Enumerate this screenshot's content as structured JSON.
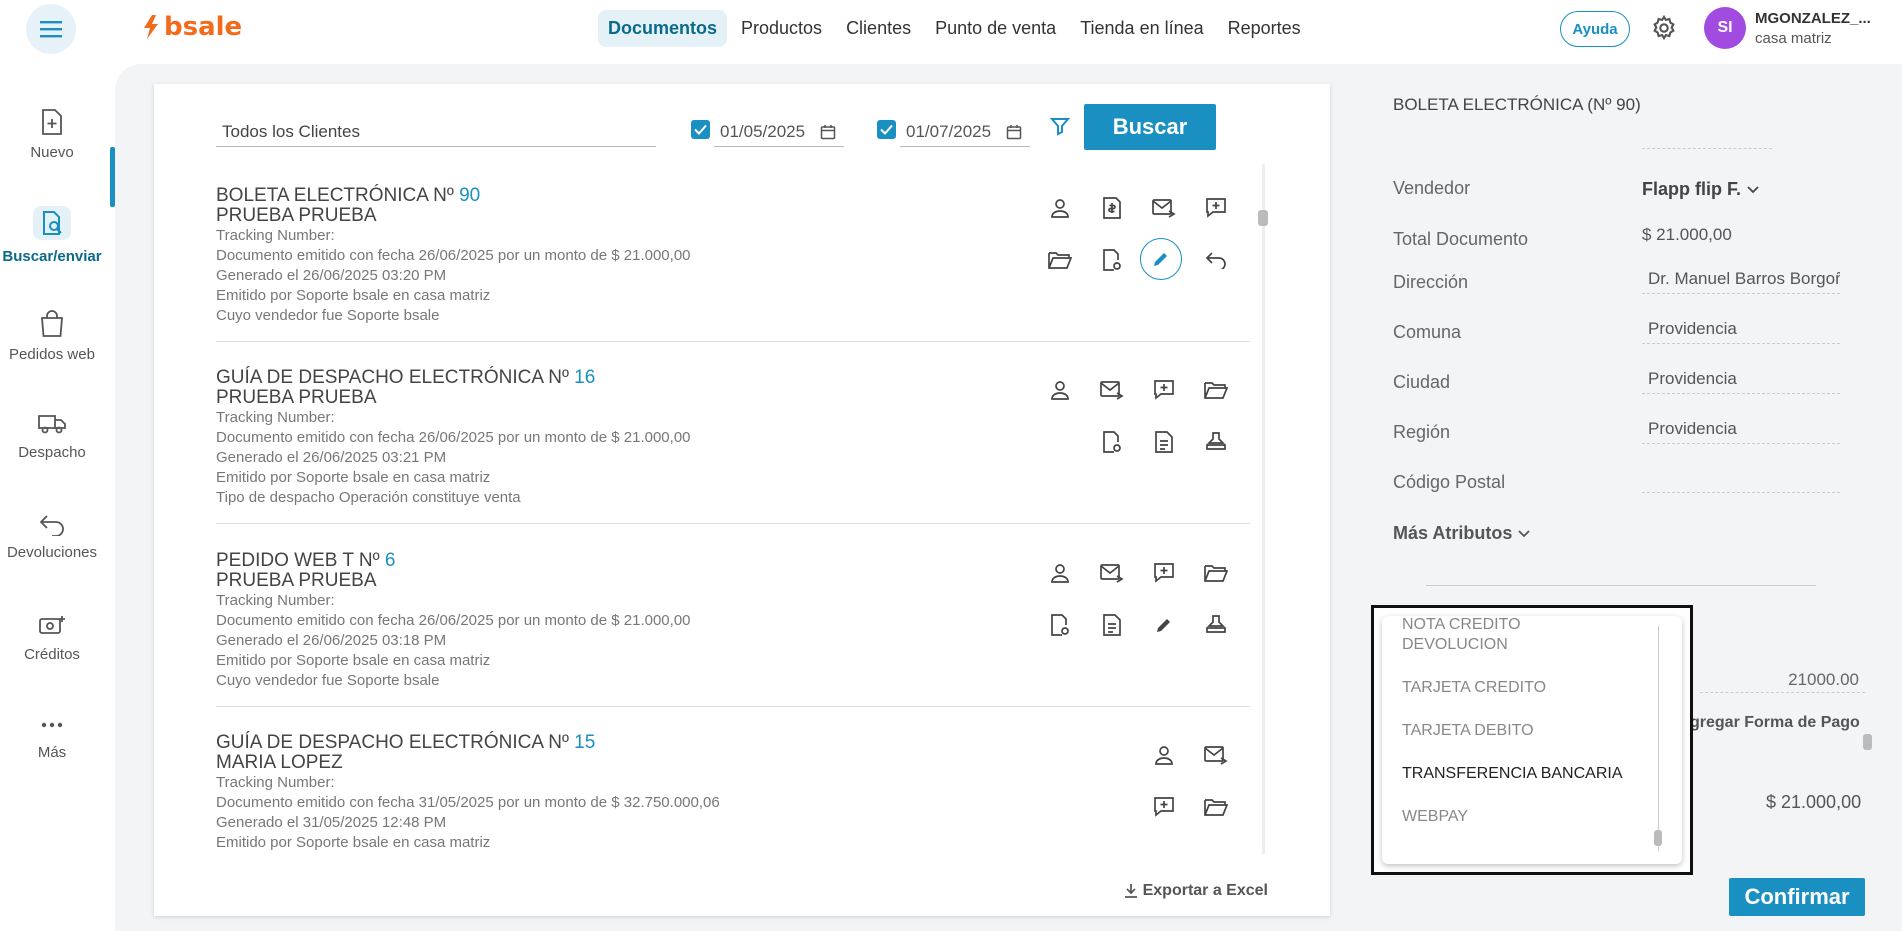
{
  "brand": {
    "name": "bsale"
  },
  "nav": {
    "items": [
      "Documentos",
      "Productos",
      "Clientes",
      "Punto de venta",
      "Tienda en línea",
      "Reportes"
    ]
  },
  "header": {
    "help": "Ayuda",
    "user_name": "MGONZALEZ_...",
    "user_branch": "casa matriz",
    "avatar": "SI"
  },
  "sidebar": {
    "items": [
      "Nuevo",
      "Buscar/enviar",
      "Pedidos web",
      "Despacho",
      "Devoluciones",
      "Créditos",
      "Más"
    ]
  },
  "filters": {
    "client": "Todos los Clientes",
    "date_from": "01/05/2025",
    "date_to": "01/07/2025",
    "search": "Buscar"
  },
  "documents": [
    {
      "title": "BOLETA ELECTRÓNICA Nº",
      "number": "90",
      "client": "PRUEBA PRUEBA",
      "lines": [
        "Tracking Number:",
        "Documento emitido con fecha 26/06/2025 por un monto de $ 21.000,00",
        "Generado el 26/06/2025 03:20 PM",
        "Emitido por Soporte bsale en casa matriz",
        "Cuyo vendedor fue Soporte bsale"
      ]
    },
    {
      "title": "GUÍA DE DESPACHO ELECTRÓNICA Nº",
      "number": "16",
      "client": "PRUEBA PRUEBA",
      "lines": [
        "Tracking Number:",
        "Documento emitido con fecha 26/06/2025 por un monto de $ 21.000,00",
        "Generado el 26/06/2025 03:21 PM",
        "Emitido por Soporte bsale en casa matriz",
        "Tipo de despacho Operación constituye venta"
      ]
    },
    {
      "title": "PEDIDO WEB T Nº",
      "number": "6",
      "client": "PRUEBA PRUEBA",
      "lines": [
        "Tracking Number:",
        "Documento emitido con fecha 26/06/2025 por un monto de $ 21.000,00",
        "Generado el 26/06/2025 03:18 PM",
        "Emitido por Soporte bsale en casa matriz",
        "Cuyo vendedor fue Soporte bsale"
      ]
    },
    {
      "title": "GUÍA DE DESPACHO ELECTRÓNICA Nº",
      "number": "15",
      "client": "MARIA LOPEZ",
      "lines": [
        "Tracking Number:",
        "Documento emitido con fecha 31/05/2025 por un monto de $ 32.750.000,06",
        "Generado el 31/05/2025 12:48 PM",
        "Emitido por Soporte bsale en casa matriz"
      ]
    }
  ],
  "export_label": "Exportar a Excel",
  "detail": {
    "title": "BOLETA ELECTRÓNICA (Nº 90)",
    "vendedor_label": "Vendedor",
    "vendedor_value": "Flapp flip F.",
    "total_label": "Total Documento",
    "total_value": "$ 21.000,00",
    "direccion_label": "Dirección",
    "direccion_value": "Dr. Manuel Barros Borgoño",
    "comuna_label": "Comuna",
    "comuna_value": "Providencia",
    "ciudad_label": "Ciudad",
    "ciudad_value": "Providencia",
    "region_label": "Región",
    "region_value": "Providencia",
    "cp_label": "Código Postal",
    "cp_value": "",
    "mas_atributos": "Más Atributos",
    "payment_amount": "21000.00",
    "add_payment": "gregar Forma de Pago",
    "payment_total": "$ 21.000,00",
    "confirm": "Confirmar"
  },
  "payment_dropdown": {
    "options": [
      "NOTA CREDITO",
      "DEVOLUCION",
      "TARJETA CREDITO",
      "TARJETA DEBITO",
      "TRANSFERENCIA BANCARIA",
      "WEBPAY"
    ],
    "highlighted": "TRANSFERENCIA BANCARIA"
  },
  "colors": {
    "accent": "#1a8fc2",
    "brand": "#f26b1d",
    "avatar": "#a24be0"
  }
}
